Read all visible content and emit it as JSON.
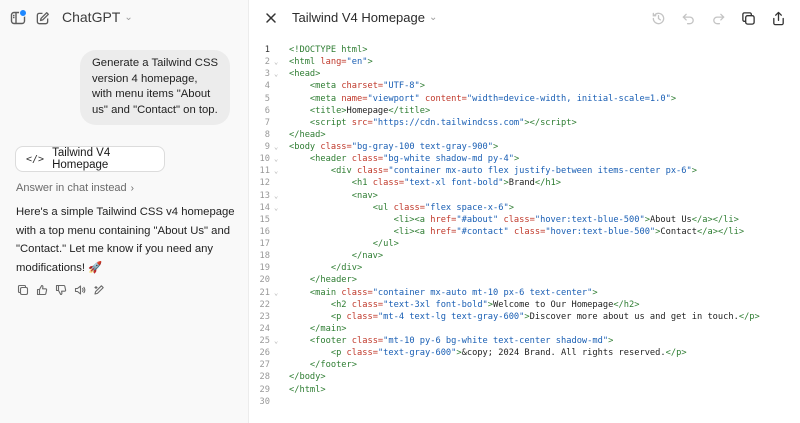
{
  "left_header": {
    "model_label": "ChatGPT"
  },
  "chat": {
    "user_message": "Generate a Tailwind CSS version 4 homepage, with menu items \"About us\" and \"Contact\" on top.",
    "canvas_card_label": "Tailwind V4 Homepage",
    "answer_in_chat_label": "Answer in chat instead",
    "assistant_message": "Here's a simple Tailwind CSS v4 homepage with a top menu containing \"About Us\" and \"Contact.\" Let me know if you need any modifications! 🚀"
  },
  "canvas": {
    "title": "Tailwind V4 Homepage",
    "icons": [
      "sidebar-icon",
      "new-chat-icon",
      "chevron-down-icon",
      "code-icon",
      "chevron-right-icon",
      "copy-icon",
      "thumbs-up-icon",
      "thumbs-down-icon",
      "read-aloud-icon",
      "edit-icon",
      "close-icon",
      "history-icon",
      "undo-icon",
      "redo-icon",
      "copy-icon",
      "share-icon"
    ],
    "code_lines": [
      {
        "n": "1",
        "fold": "",
        "html": "<span class='tag'>&lt;!DOCTYPE html&gt;</span>"
      },
      {
        "n": "2",
        "fold": "⌄",
        "html": "<span class='tag'>&lt;html</span> <span class='attr'>lang=</span><span class='str'>\"en\"</span><span class='tag'>&gt;</span>"
      },
      {
        "n": "3",
        "fold": "⌄",
        "html": "<span class='tag'>&lt;head&gt;</span>"
      },
      {
        "n": "4",
        "fold": "",
        "html": "    <span class='tag'>&lt;meta</span> <span class='attr'>charset=</span><span class='str'>\"UTF-8\"</span><span class='tag'>&gt;</span>"
      },
      {
        "n": "5",
        "fold": "",
        "html": "    <span class='tag'>&lt;meta</span> <span class='attr'>name=</span><span class='str'>\"viewport\"</span> <span class='attr'>content=</span><span class='str'>\"width=device-width, initial-scale=1.0\"</span><span class='tag'>&gt;</span>"
      },
      {
        "n": "6",
        "fold": "",
        "html": "    <span class='tag'>&lt;title&gt;</span>Homepage<span class='tag'>&lt;/title&gt;</span>"
      },
      {
        "n": "7",
        "fold": "",
        "html": "    <span class='tag'>&lt;script</span> <span class='attr'>src=</span><span class='str'>\"https://cdn.tailwindcss.com\"</span><span class='tag'>&gt;&lt;/script&gt;</span>"
      },
      {
        "n": "8",
        "fold": "",
        "html": "<span class='tag'>&lt;/head&gt;</span>"
      },
      {
        "n": "9",
        "fold": "⌄",
        "html": "<span class='tag'>&lt;body</span> <span class='attr'>class=</span><span class='str'>\"bg-gray-100 text-gray-900\"</span><span class='tag'>&gt;</span>"
      },
      {
        "n": "10",
        "fold": "⌄",
        "html": "    <span class='tag'>&lt;header</span> <span class='attr'>class=</span><span class='str'>\"bg-white shadow-md py-4\"</span><span class='tag'>&gt;</span>"
      },
      {
        "n": "11",
        "fold": "⌄",
        "html": "        <span class='tag'>&lt;div</span> <span class='attr'>class=</span><span class='str'>\"container mx-auto flex justify-between items-center px-6\"</span><span class='tag'>&gt;</span>"
      },
      {
        "n": "12",
        "fold": "",
        "html": "            <span class='tag'>&lt;h1</span> <span class='attr'>class=</span><span class='str'>\"text-xl font-bold\"</span><span class='tag'>&gt;</span>Brand<span class='tag'>&lt;/h1&gt;</span>"
      },
      {
        "n": "13",
        "fold": "⌄",
        "html": "            <span class='tag'>&lt;nav&gt;</span>"
      },
      {
        "n": "14",
        "fold": "⌄",
        "html": "                <span class='tag'>&lt;ul</span> <span class='attr'>class=</span><span class='str'>\"flex space-x-6\"</span><span class='tag'>&gt;</span>"
      },
      {
        "n": "15",
        "fold": "",
        "html": "                    <span class='tag'>&lt;li&gt;&lt;a</span> <span class='attr'>href=</span><span class='str'>\"#about\"</span> <span class='attr'>class=</span><span class='str'>\"hover:text-blue-500\"</span><span class='tag'>&gt;</span>About Us<span class='tag'>&lt;/a&gt;&lt;/li&gt;</span>"
      },
      {
        "n": "16",
        "fold": "",
        "html": "                    <span class='tag'>&lt;li&gt;&lt;a</span> <span class='attr'>href=</span><span class='str'>\"#contact\"</span> <span class='attr'>class=</span><span class='str'>\"hover:text-blue-500\"</span><span class='tag'>&gt;</span>Contact<span class='tag'>&lt;/a&gt;&lt;/li&gt;</span>"
      },
      {
        "n": "17",
        "fold": "",
        "html": "                <span class='tag'>&lt;/ul&gt;</span>"
      },
      {
        "n": "18",
        "fold": "",
        "html": "            <span class='tag'>&lt;/nav&gt;</span>"
      },
      {
        "n": "19",
        "fold": "",
        "html": "        <span class='tag'>&lt;/div&gt;</span>"
      },
      {
        "n": "20",
        "fold": "",
        "html": "    <span class='tag'>&lt;/header&gt;</span>"
      },
      {
        "n": "21",
        "fold": "⌄",
        "html": "    <span class='tag'>&lt;main</span> <span class='attr'>class=</span><span class='str'>\"container mx-auto mt-10 px-6 text-center\"</span><span class='tag'>&gt;</span>"
      },
      {
        "n": "22",
        "fold": "",
        "html": "        <span class='tag'>&lt;h2</span> <span class='attr'>class=</span><span class='str'>\"text-3xl font-bold\"</span><span class='tag'>&gt;</span>Welcome to Our Homepage<span class='tag'>&lt;/h2&gt;</span>"
      },
      {
        "n": "23",
        "fold": "",
        "html": "        <span class='tag'>&lt;p</span> <span class='attr'>class=</span><span class='str'>\"mt-4 text-lg text-gray-600\"</span><span class='tag'>&gt;</span>Discover more about us and get in touch.<span class='tag'>&lt;/p&gt;</span>"
      },
      {
        "n": "24",
        "fold": "",
        "html": "    <span class='tag'>&lt;/main&gt;</span>"
      },
      {
        "n": "25",
        "fold": "⌄",
        "html": "    <span class='tag'>&lt;footer</span> <span class='attr'>class=</span><span class='str'>\"mt-10 py-6 bg-white text-center shadow-md\"</span><span class='tag'>&gt;</span>"
      },
      {
        "n": "26",
        "fold": "",
        "html": "        <span class='tag'>&lt;p</span> <span class='attr'>class=</span><span class='str'>\"text-gray-600\"</span><span class='tag'>&gt;</span>&amp;copy; 2024 Brand. All rights reserved.<span class='tag'>&lt;/p&gt;</span>"
      },
      {
        "n": "27",
        "fold": "",
        "html": "    <span class='tag'>&lt;/footer&gt;</span>"
      },
      {
        "n": "28",
        "fold": "",
        "html": "<span class='tag'>&lt;/body&gt;</span>"
      },
      {
        "n": "29",
        "fold": "",
        "html": "<span class='tag'>&lt;/html&gt;</span>"
      },
      {
        "n": "30",
        "fold": "",
        "html": ""
      }
    ]
  }
}
